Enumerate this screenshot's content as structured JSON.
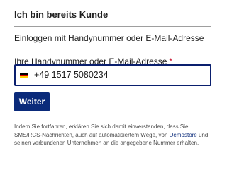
{
  "heading": "Ich bin bereits Kunde",
  "subheading": "Einloggen mit Handynummer oder E-Mail-Adresse",
  "field": {
    "label": "Ihre Handynummer oder E-Mail-Adresse",
    "required_mark": "*",
    "value": "+49 1517 5080234",
    "country_flag_icon": "flag-de-icon",
    "flag_colors": [
      "#000000",
      "#dd0000",
      "#ffce00"
    ]
  },
  "submit_label": "Weiter",
  "legal": {
    "text_before": "Indem Sie fortfahren, erklären Sie sich damit einverstanden, dass Sie SMS/RCS-Nachrichten, auch auf automatisiertem Wege, von ",
    "link_text": "Demostore",
    "text_after": " und seinen verbundenen Unternehmen an die angegebene Nummer erhalten."
  },
  "colors": {
    "accent": "#0a2a7a",
    "required": "#c8102e",
    "divider": "#9e9e9e"
  }
}
